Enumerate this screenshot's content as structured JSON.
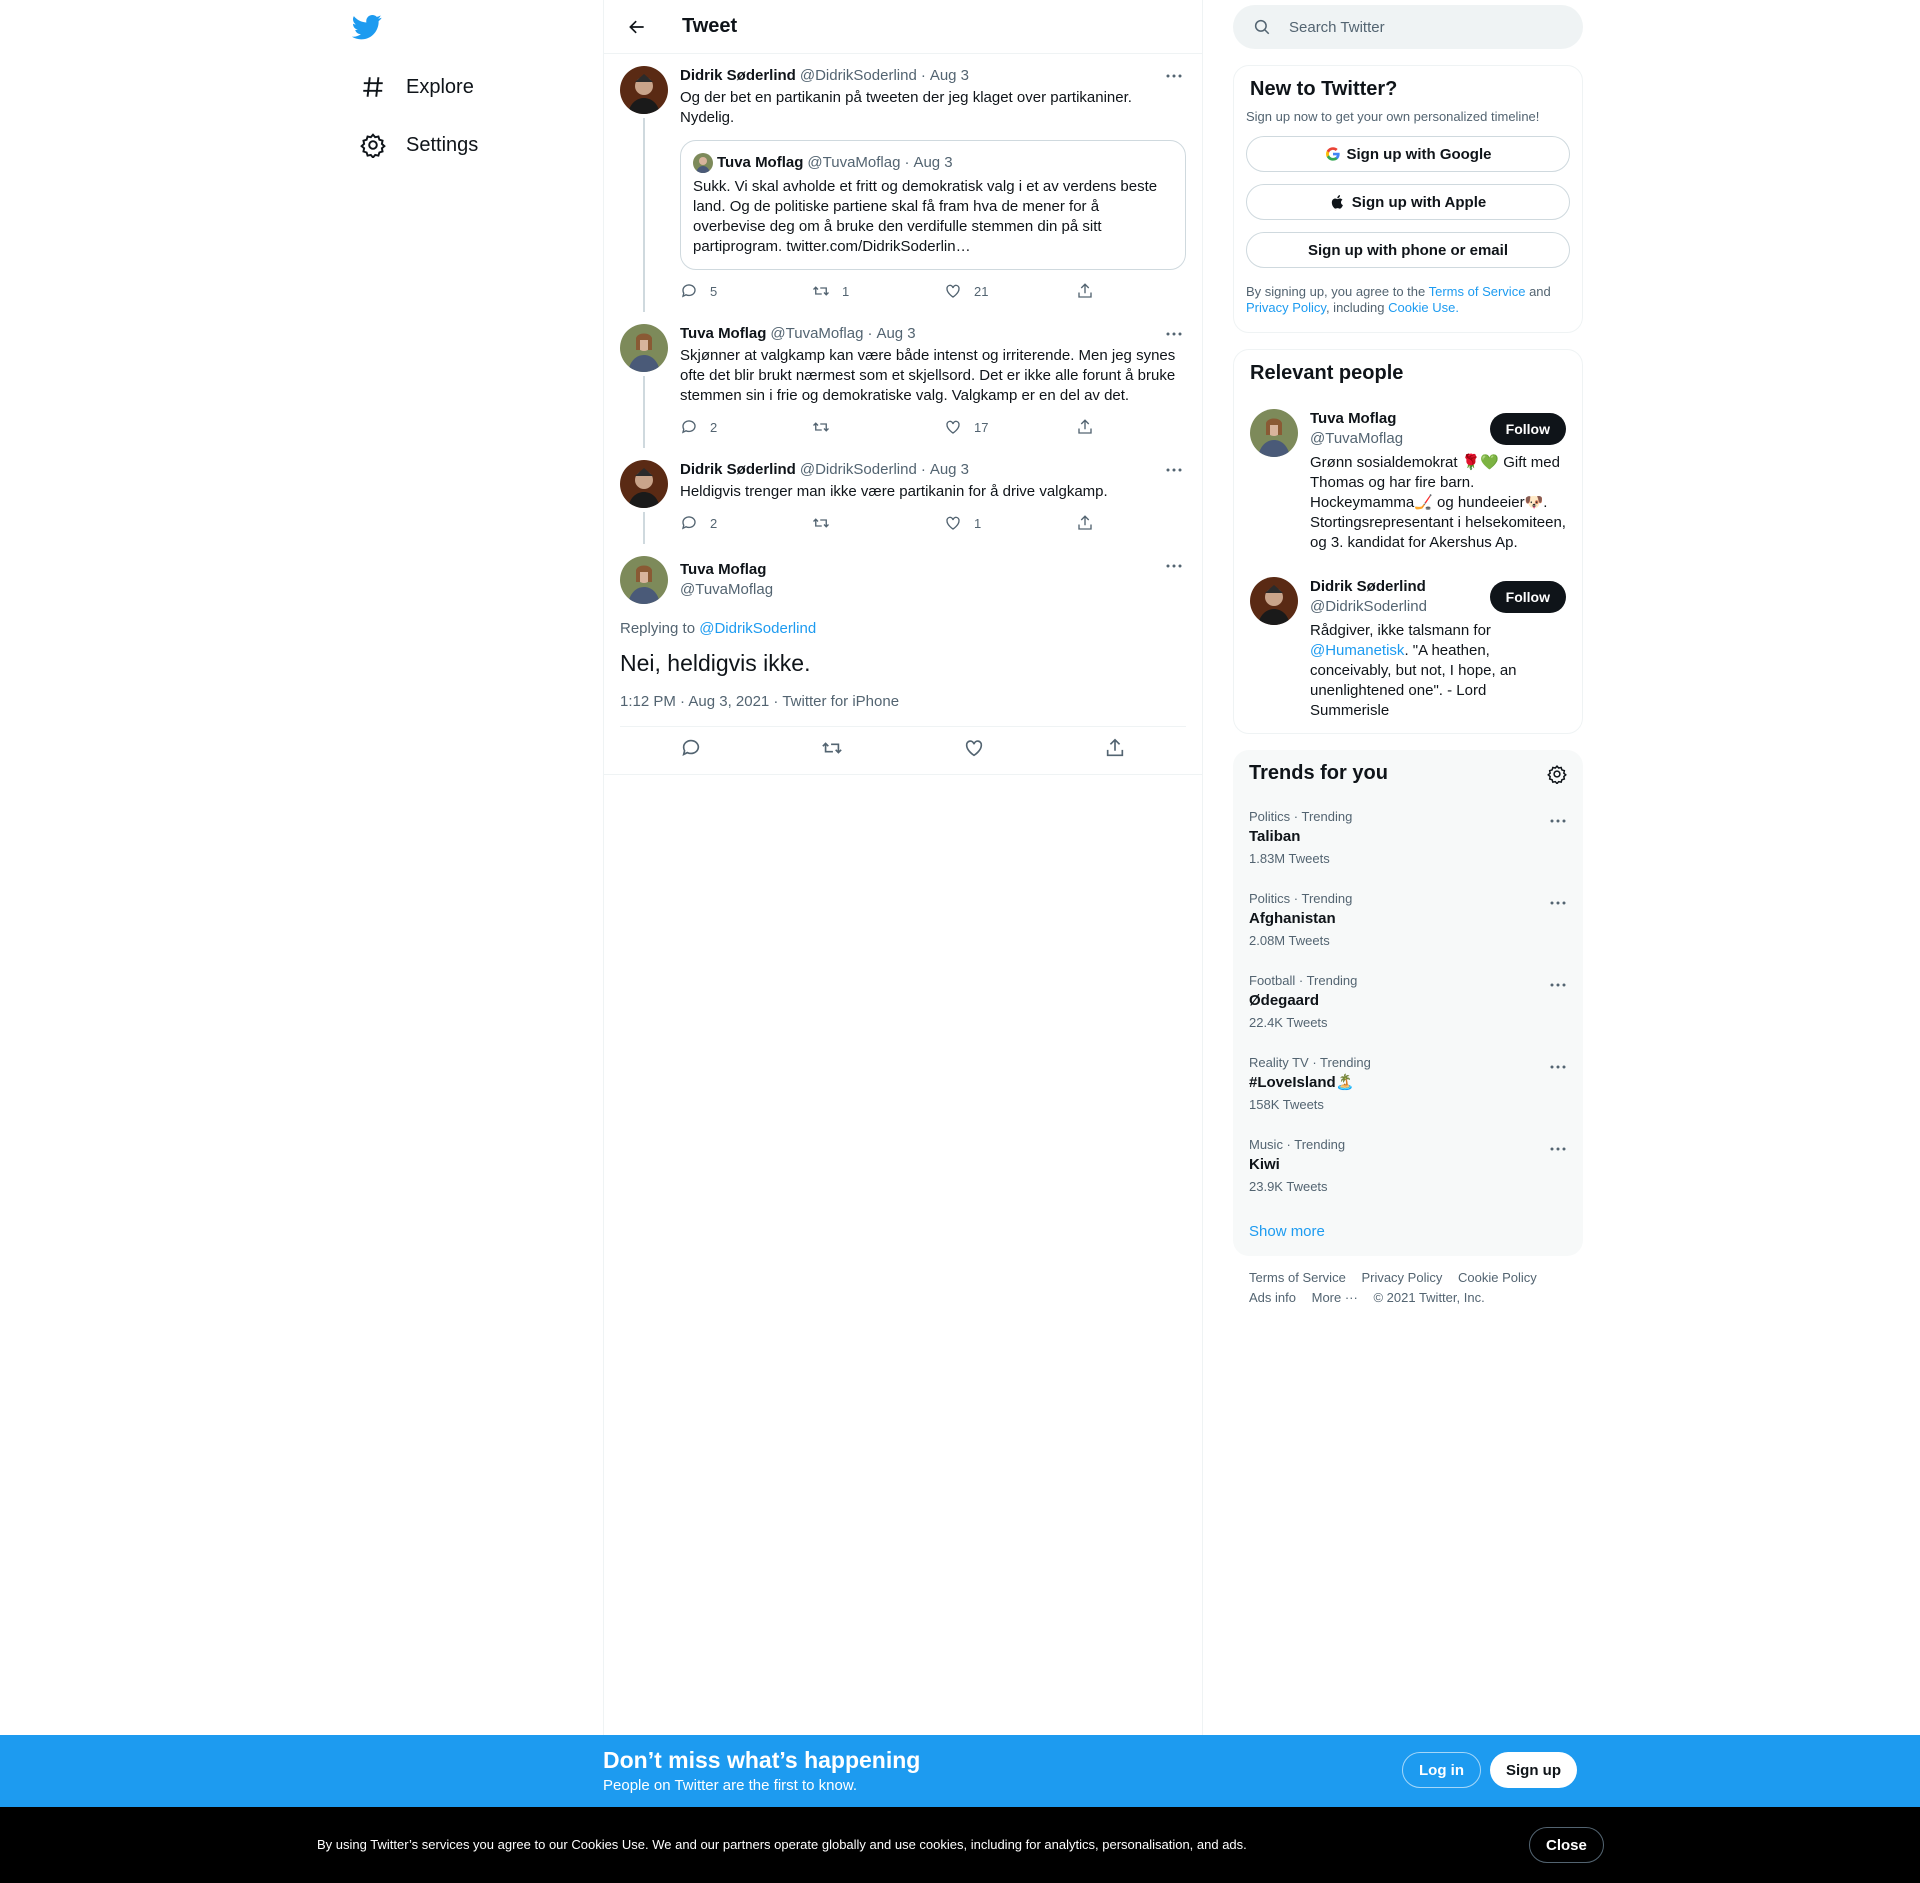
{
  "nav": {
    "items": [
      {
        "label": "Explore",
        "icon": "hashtag-icon"
      },
      {
        "label": "Settings",
        "icon": "gear-icon"
      }
    ]
  },
  "header": {
    "title": "Tweet"
  },
  "thread": [
    {
      "name": "Didrik Søderlind",
      "handle": "@DidrikSoderlind",
      "date": "Aug 3",
      "text": "Og der bet en partikanin på tweeten der jeg klaget over partikaniner. Nydelig.",
      "quote": {
        "name": "Tuva Moflag",
        "handle": "@TuvaMoflag",
        "date": "Aug 3",
        "text": "Sukk. Vi skal avholde et fritt og demokratisk valg i et av verdens beste land. Og de politiske partiene skal få fram hva de mener for å overbevise deg om å bruke den verdifulle stemmen din på sitt partiprogram. twitter.com/DidrikSoderlin…"
      },
      "replies": "5",
      "retweets": "1",
      "likes": "21"
    },
    {
      "name": "Tuva Moflag",
      "handle": "@TuvaMoflag",
      "date": "Aug 3",
      "text": "Skjønner at valgkamp kan være både intenst og irriterende. Men jeg synes ofte det blir brukt nærmest som et skjellsord. Det er ikke alle forunt å bruke stemmen sin i frie og demokratiske valg. Valgkamp er en del av det.",
      "replies": "2",
      "retweets": "",
      "likes": "17"
    },
    {
      "name": "Didrik Søderlind",
      "handle": "@DidrikSoderlind",
      "date": "Aug 3",
      "text": "Heldigvis trenger man ikke være partikanin for å drive valgkamp.",
      "replies": "2",
      "retweets": "",
      "likes": "1"
    }
  ],
  "focus": {
    "name": "Tuva Moflag",
    "handle": "@TuvaMoflag",
    "replying_prefix": "Replying to",
    "replying_to": "@DidrikSoderlind",
    "text": "Nei, heldigvis ikke.",
    "timestamp": "1:12 PM · Aug 3, 2021 · Twitter for iPhone"
  },
  "search": {
    "placeholder": "Search Twitter"
  },
  "signup": {
    "title": "New to Twitter?",
    "subtitle": "Sign up now to get your own personalized timeline!",
    "google": "Sign up with Google",
    "apple": "Sign up with Apple",
    "phone": "Sign up with phone or email",
    "tos_1": "By signing up, you agree to the",
    "tos_link": "Terms of Service",
    "tos_2": "and",
    "privacy_link": "Privacy Policy",
    "tos_3": ", including",
    "cookie_link": "Cookie Use."
  },
  "people": {
    "title": "Relevant people",
    "follow_label": "Follow",
    "list": [
      {
        "name": "Tuva Moflag",
        "handle": "@TuvaMoflag",
        "bio": "Grønn sosialdemokrat 🌹💚 Gift med Thomas og har fire barn. Hockeymamma🏒 og hundeeier🐶. Stortingsrepresentant i helsekomiteen, og 3. kandidat for Akershus Ap."
      },
      {
        "name": "Didrik Søderlind",
        "handle": "@DidrikSoderlind",
        "bio_1": "Rådgiver, ikke talsmann for",
        "bio_link": "@Humanetisk",
        "bio_2": ". \"A heathen, conceivably, but not, I hope, an unenlightened one\". - Lord Summerisle"
      }
    ]
  },
  "trends": {
    "title": "Trends for you",
    "items": [
      {
        "category": "Politics · Trending",
        "name": "Taliban",
        "count": "1.83M Tweets"
      },
      {
        "category": "Politics · Trending",
        "name": "Afghanistan",
        "count": "2.08M Tweets"
      },
      {
        "category": "Football · Trending",
        "name": "Ødegaard",
        "count": "22.4K Tweets"
      },
      {
        "category": "Reality TV · Trending",
        "name": "#LoveIsland🏝️",
        "count": "158K Tweets"
      },
      {
        "category": "Music · Trending",
        "name": "Kiwi",
        "count": "23.9K Tweets"
      }
    ],
    "show_more": "Show more"
  },
  "footer": {
    "terms": "Terms of Service",
    "privacy": "Privacy Policy",
    "cookie": "Cookie Policy",
    "ads": "Ads info",
    "more": "More ···",
    "copyright": "© 2021 Twitter, Inc."
  },
  "banner": {
    "title": "Don’t miss what’s happening",
    "subtitle": "People on Twitter are the first to know.",
    "login": "Log in",
    "signup": "Sign up"
  },
  "cookie_bar": {
    "text": "By using Twitter’s services you agree to our Cookies Use. We and our partners operate globally and use cookies, including for analytics, personalisation, and ads.",
    "close": "Close"
  },
  "colors": {
    "accent": "#1d9bf0",
    "text": "#0f1419",
    "secondary": "#536471"
  }
}
